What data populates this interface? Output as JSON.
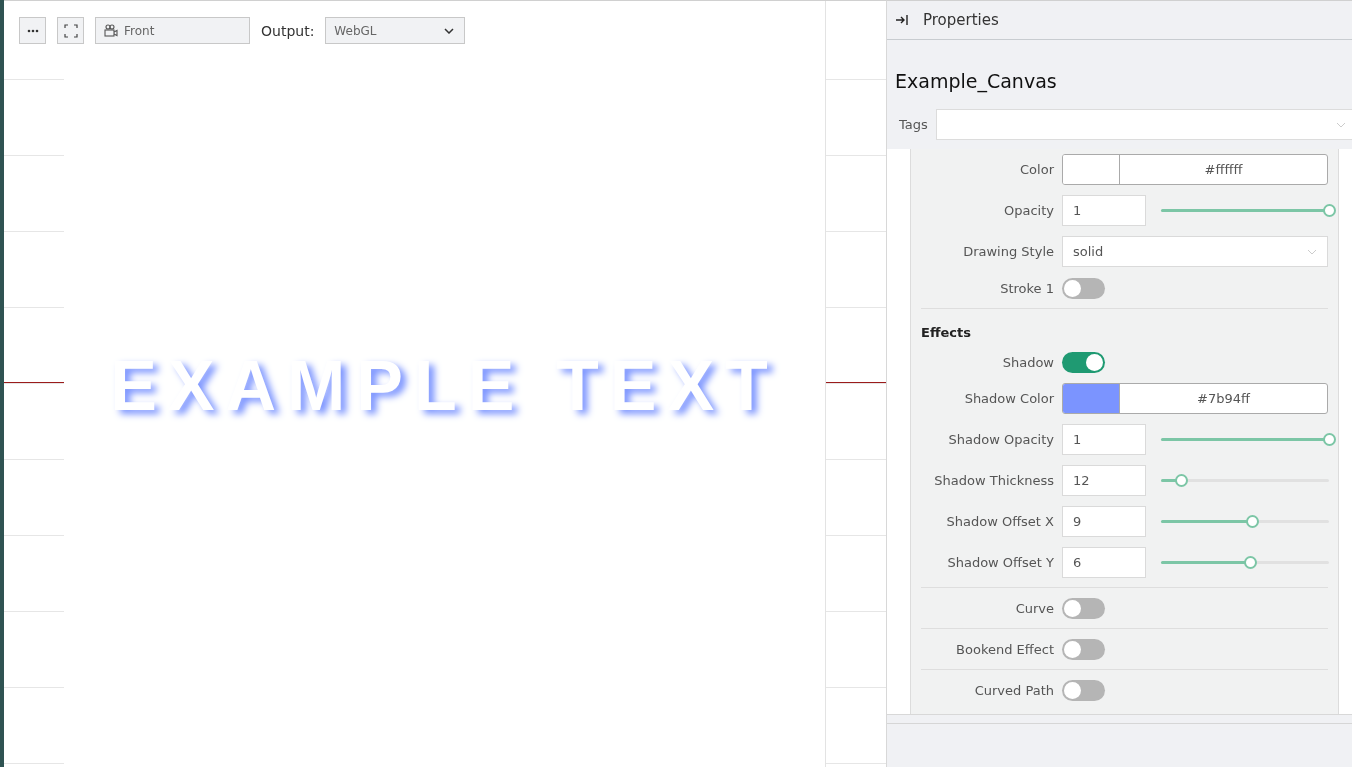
{
  "toolbar": {
    "view_field": "Front",
    "output_label": "Output:",
    "output_value": "WebGL"
  },
  "canvas": {
    "text": "EXAMPLE TEXT"
  },
  "properties": {
    "header": "Properties",
    "object_name": "Example_Canvas",
    "tags_label": "Tags",
    "groups": [
      {
        "rows": [
          {
            "kind": "color",
            "label": "Color",
            "value": "#ffffff",
            "color": "#ffffff"
          },
          {
            "kind": "slider",
            "label": "Opacity",
            "value": "1",
            "level": 1
          },
          {
            "kind": "select",
            "label": "Drawing Style",
            "value": "solid"
          },
          {
            "kind": "toggle",
            "label": "Stroke 1",
            "on": false
          }
        ]
      },
      {
        "heading": "Effects",
        "rows": [
          {
            "kind": "toggle",
            "label": "Shadow",
            "on": true
          },
          {
            "kind": "color",
            "label": "Shadow Color",
            "value": "#7b94ff",
            "color": "#7b94ff"
          },
          {
            "kind": "slider",
            "label": "Shadow Opacity",
            "value": "1",
            "level": 1
          },
          {
            "kind": "slider",
            "label": "Shadow Thickness",
            "value": "12",
            "level": 0.12
          },
          {
            "kind": "slider",
            "label": "Shadow Offset X",
            "value": "9",
            "level": 0.54
          },
          {
            "kind": "slider",
            "label": "Shadow Offset Y",
            "value": "6",
            "level": 0.53
          }
        ]
      },
      {
        "rows": [
          {
            "kind": "toggle",
            "label": "Curve",
            "on": false
          }
        ]
      },
      {
        "rows": [
          {
            "kind": "toggle",
            "label": "Bookend Effect",
            "on": false
          }
        ]
      },
      {
        "rows": [
          {
            "kind": "toggle",
            "label": "Curved Path",
            "on": false
          }
        ]
      }
    ]
  }
}
